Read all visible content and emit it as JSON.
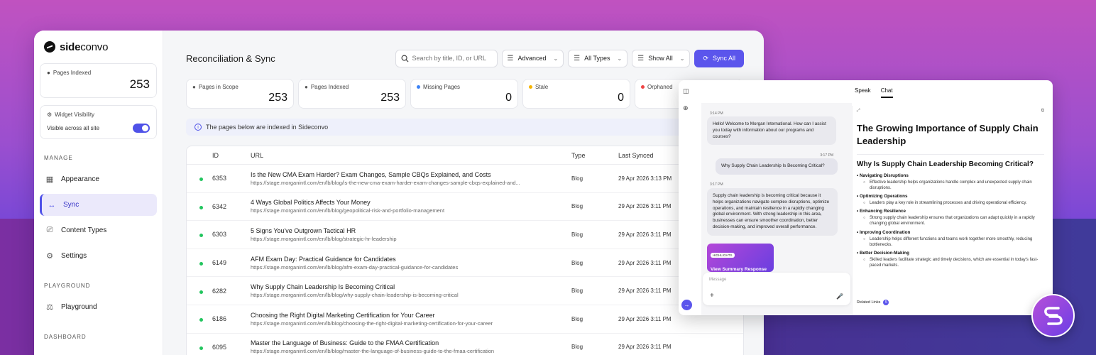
{
  "brand": {
    "name_bold": "side",
    "name_light": "convo"
  },
  "sidebar": {
    "pages_indexed": {
      "label": "Pages Indexed",
      "value": "253"
    },
    "widget": {
      "label": "Widget Visibility",
      "status": "Visible across all site",
      "enabled": true
    },
    "sections": [
      {
        "title": "MANAGE",
        "items": [
          {
            "label": "Appearance",
            "icon": "grid-icon",
            "active": false
          },
          {
            "label": "Sync",
            "icon": "swap-arrows-icon",
            "active": true
          },
          {
            "label": "Content Types",
            "icon": "clipboard-icon",
            "active": false
          },
          {
            "label": "Settings",
            "icon": "gear-icon",
            "active": false
          }
        ]
      },
      {
        "title": "PLAYGROUND",
        "items": [
          {
            "label": "Playground",
            "icon": "flask-icon",
            "active": false
          }
        ]
      },
      {
        "title": "DASHBOARD",
        "items": []
      }
    ]
  },
  "header": {
    "title": "Reconciliation & Sync",
    "search_placeholder": "Search by title, ID, or URL",
    "filters": [
      "Advanced",
      "All Types",
      "Show All"
    ],
    "sync_button": "Sync All"
  },
  "stats": [
    {
      "label": "Pages in Scope",
      "value": "253",
      "icon": "wordpress-icon",
      "color": ""
    },
    {
      "label": "Pages Indexed",
      "value": "253",
      "icon": "sideconvo-icon",
      "color": ""
    },
    {
      "label": "Missing Pages",
      "value": "0",
      "icon": "dot",
      "color": "#3b82f6"
    },
    {
      "label": "Stale",
      "value": "0",
      "icon": "dot",
      "color": "#f5b400"
    },
    {
      "label": "Orphaned",
      "value": "",
      "icon": "dot",
      "color": "#ef4444"
    }
  ],
  "info_text": "The pages below are indexed in Sideconvo",
  "table": {
    "columns": {
      "id": "ID",
      "url": "URL",
      "type": "Type",
      "synced": "Last Synced"
    },
    "status_color": "#22c55e",
    "rows": [
      {
        "id": "6353",
        "title": "Is the New CMA Exam Harder? Exam Changes, Sample CBQs Explained, and Costs",
        "url": "https://stage.morganintl.com/en/lb/blog/is-the-new-cma-exam-harder-exam-changes-sample-cbqs-explained-and...",
        "type": "Blog",
        "synced": "29 Apr 2026 3:13 PM"
      },
      {
        "id": "6342",
        "title": "4 Ways Global Politics Affects Your Money",
        "url": "https://stage.morganintl.com/en/lb/blog/geopolitical-risk-and-portfolio-management",
        "type": "Blog",
        "synced": "29 Apr 2026 3:11 PM"
      },
      {
        "id": "6303",
        "title": "5 Signs You've Outgrown Tactical HR",
        "url": "https://stage.morganintl.com/en/lb/blog/strategic-hr-leadership",
        "type": "Blog",
        "synced": "29 Apr 2026 3:11 PM"
      },
      {
        "id": "6149",
        "title": "AFM Exam Day: Practical Guidance for Candidates",
        "url": "https://stage.morganintl.com/en/lb/blog/afm-exam-day-practical-guidance-for-candidates",
        "type": "Blog",
        "synced": "29 Apr 2026 3:11 PM"
      },
      {
        "id": "6282",
        "title": "Why Supply Chain Leadership Is Becoming Critical",
        "url": "https://stage.morganintl.com/en/lb/blog/why-supply-chain-leadership-is-becoming-critical",
        "type": "Blog",
        "synced": "29 Apr 2026 3:11 PM"
      },
      {
        "id": "6186",
        "title": "Choosing the Right Digital Marketing Certification for Your Career",
        "url": "https://stage.morganintl.com/en/lb/blog/choosing-the-right-digital-marketing-certification-for-your-career",
        "type": "Blog",
        "synced": "29 Apr 2026 3:11 PM"
      },
      {
        "id": "6095",
        "title": "Master the Language of Business: Guide to the FMAA Certification",
        "url": "https://stage.morganintl.com/en/lb/blog/master-the-language-of-business-guide-to-the-fmaa-certification",
        "type": "Blog",
        "synced": "29 Apr 2026 3:11 PM"
      }
    ]
  },
  "widget": {
    "tabs": [
      "Speak",
      "Chat"
    ],
    "messages": [
      {
        "from": "bot",
        "time": "3:14 PM",
        "text": "Hello! Welcome to Morgan International. How can I assist you today with information about our programs and courses?"
      },
      {
        "from": "user",
        "time": "3:17 PM",
        "text": "Why Supply Chain Leadership Is Becoming Critical?"
      },
      {
        "from": "bot",
        "time": "3:17 PM",
        "text": "Supply chain leadership is becoming critical because it helps organizations navigate complex disruptions, optimize operations, and maintain resilience in a rapidly changing global environment. With strong leadership in this area, businesses can ensure smoother coordination, better decision-making, and improved overall performance."
      }
    ],
    "highlights": {
      "tag": "HIGHLIGHTS",
      "text": "View Summary Response"
    },
    "composer_placeholder": "Message",
    "panel": {
      "title": "The Growing Importance of Supply Chain Leadership",
      "subtitle": "Why Is Supply Chain Leadership Becoming Critical?",
      "points": [
        {
          "head": "Navigating Disruptions",
          "desc": "Effective leadership helps organizations handle complex and unexpected supply chain disruptions."
        },
        {
          "head": "Optimizing Operations",
          "desc": "Leaders play a key role in streamlining processes and driving operational efficiency."
        },
        {
          "head": "Enhancing Resilience",
          "desc": "Strong supply chain leadership ensures that organizations can adapt quickly in a rapidly changing global environment."
        },
        {
          "head": "Improving Coordination",
          "desc": "Leadership helps different functions and teams work together more smoothly, reducing bottlenecks."
        },
        {
          "head": "Better Decision-Making",
          "desc": "Skilled leaders facilitate strategic and timely decisions, which are essential in today's fast-paced markets."
        }
      ],
      "related_label": "Related Links",
      "related_count": "5"
    }
  }
}
